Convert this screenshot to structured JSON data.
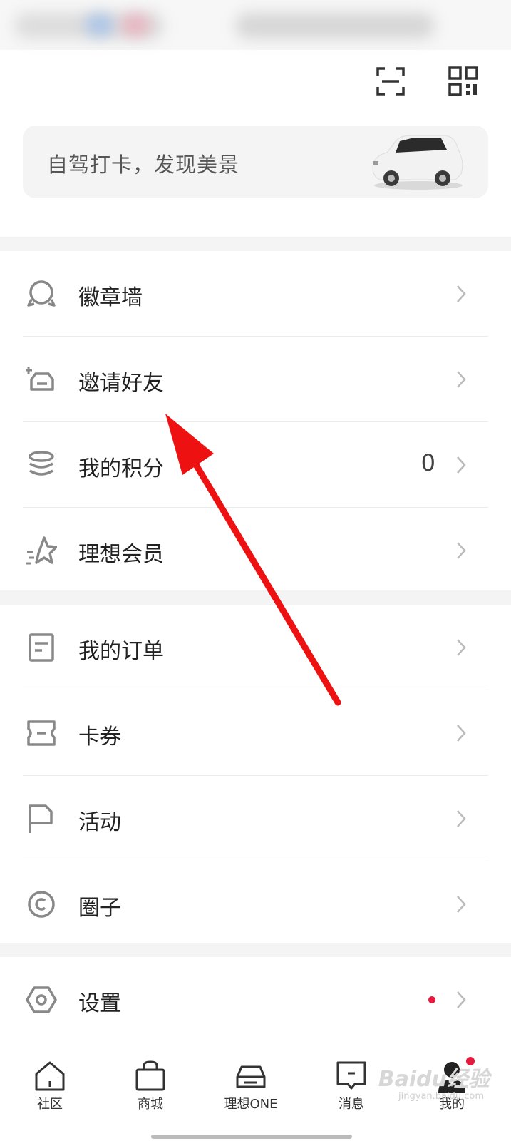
{
  "banner": {
    "text": "自驾打卡，发现美景"
  },
  "group1": [
    {
      "label": "徽章墙",
      "icon": "badge-icon"
    },
    {
      "label": "邀请好友",
      "icon": "invite-car-icon"
    },
    {
      "label": "我的积分",
      "icon": "points-coins-icon",
      "value": "0"
    },
    {
      "label": "理想会员",
      "icon": "member-star-icon"
    }
  ],
  "group2": [
    {
      "label": "我的订单",
      "icon": "order-icon"
    },
    {
      "label": "卡券",
      "icon": "coupon-icon"
    },
    {
      "label": "活动",
      "icon": "flag-icon"
    },
    {
      "label": "圈子",
      "icon": "circle-icon"
    }
  ],
  "group3": [
    {
      "label": "设置",
      "icon": "settings-icon",
      "has_dot": true
    }
  ],
  "tabbar": [
    {
      "label": "社区",
      "icon": "home-icon"
    },
    {
      "label": "商城",
      "icon": "shop-bag-icon"
    },
    {
      "label": "理想ONE",
      "icon": "car-icon"
    },
    {
      "label": "消息",
      "icon": "message-icon"
    },
    {
      "label": "我的",
      "icon": "profile-icon",
      "active": true,
      "badge": true
    }
  ],
  "watermark": {
    "text": "Baidu经验",
    "sub": "jingyan.baidu.com"
  },
  "colors": {
    "accent_red": "#e6193e",
    "annotation_arrow": "#ee1111"
  }
}
